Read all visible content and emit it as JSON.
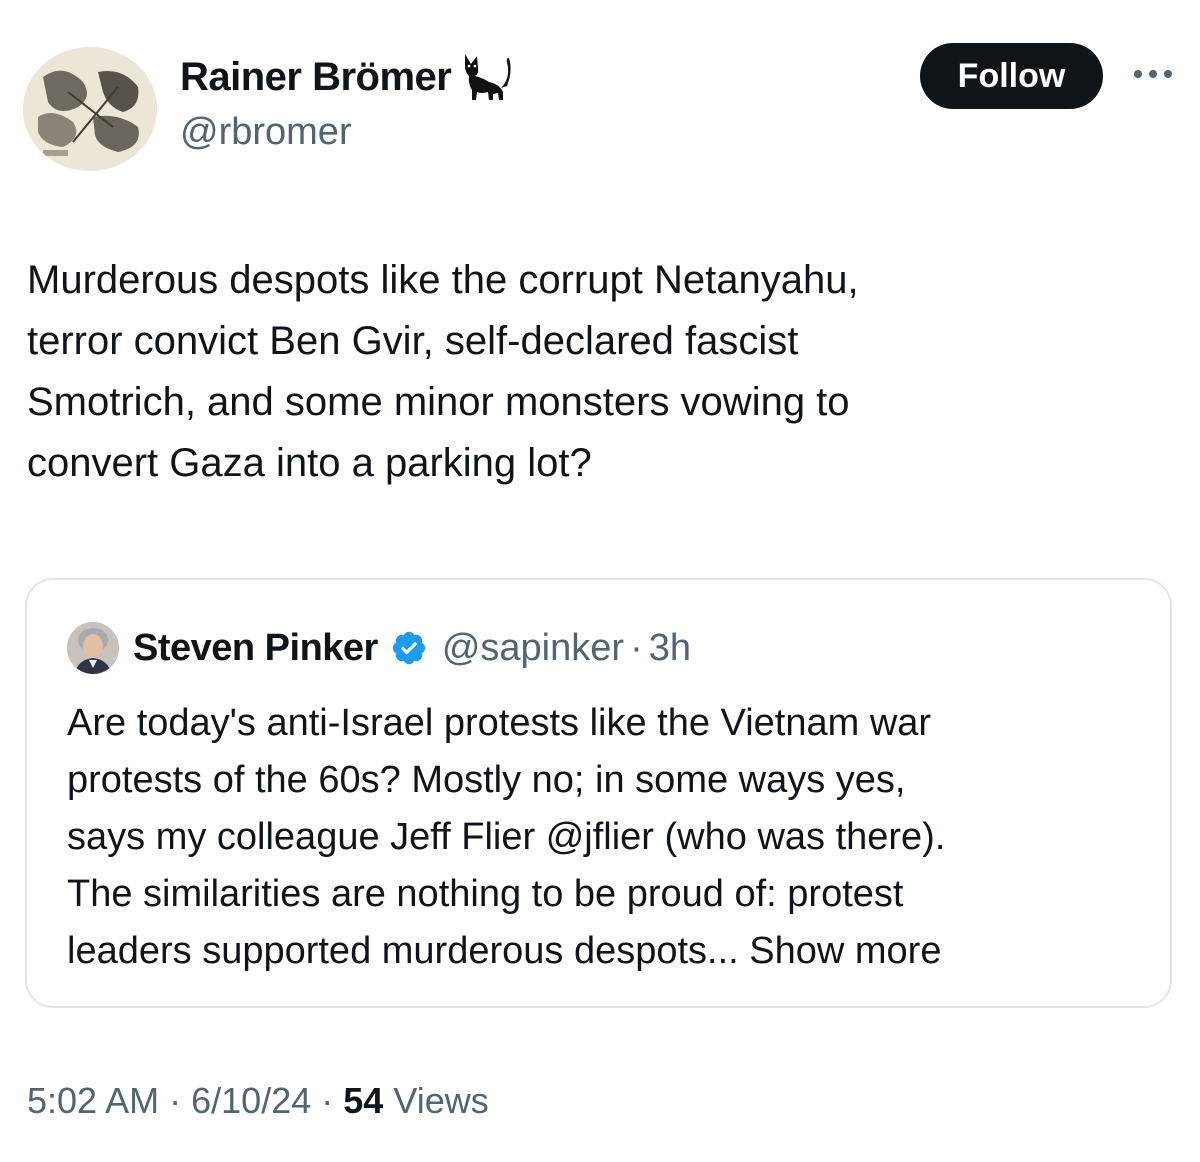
{
  "author": {
    "display_name": "Rainer Brömer",
    "handle": "@rbromer",
    "name_emoji_icon": "cat-icon"
  },
  "actions": {
    "follow_label": "Follow",
    "more_icon": "more-horizontal-icon"
  },
  "tweet": {
    "lines": [
      "Murderous despots like the corrupt Netanyahu,",
      "terror convict Ben Gvir, self-declared fascist",
      "Smotrich, and some minor monsters vowing to",
      "convert Gaza into a parking lot?"
    ]
  },
  "quote": {
    "display_name": "Steven Pinker",
    "verified_icon": "verified-badge-icon",
    "handle": "@sapinker",
    "separator": "·",
    "time": "3h",
    "lines": [
      "Are today's anti-Israel protests like the Vietnam war",
      "protests of the 60s?  Mostly no; in some ways yes,",
      "says my colleague Jeff Flier @jflier (who was there).",
      "The similarities are nothing to be proud of:  protest",
      "leaders supported murderous despots..."
    ],
    "show_more_label": "Show more"
  },
  "meta": {
    "time": "5:02 AM",
    "sep1": "·",
    "date": "6/10/24",
    "sep2": "·",
    "views_count": "54",
    "views_label": "Views"
  },
  "colors": {
    "text_primary": "#0f1419",
    "text_secondary": "#536471",
    "verified_blue": "#1d9bf0",
    "card_border": "#e1e6ea",
    "button_bg": "#0f1419"
  }
}
